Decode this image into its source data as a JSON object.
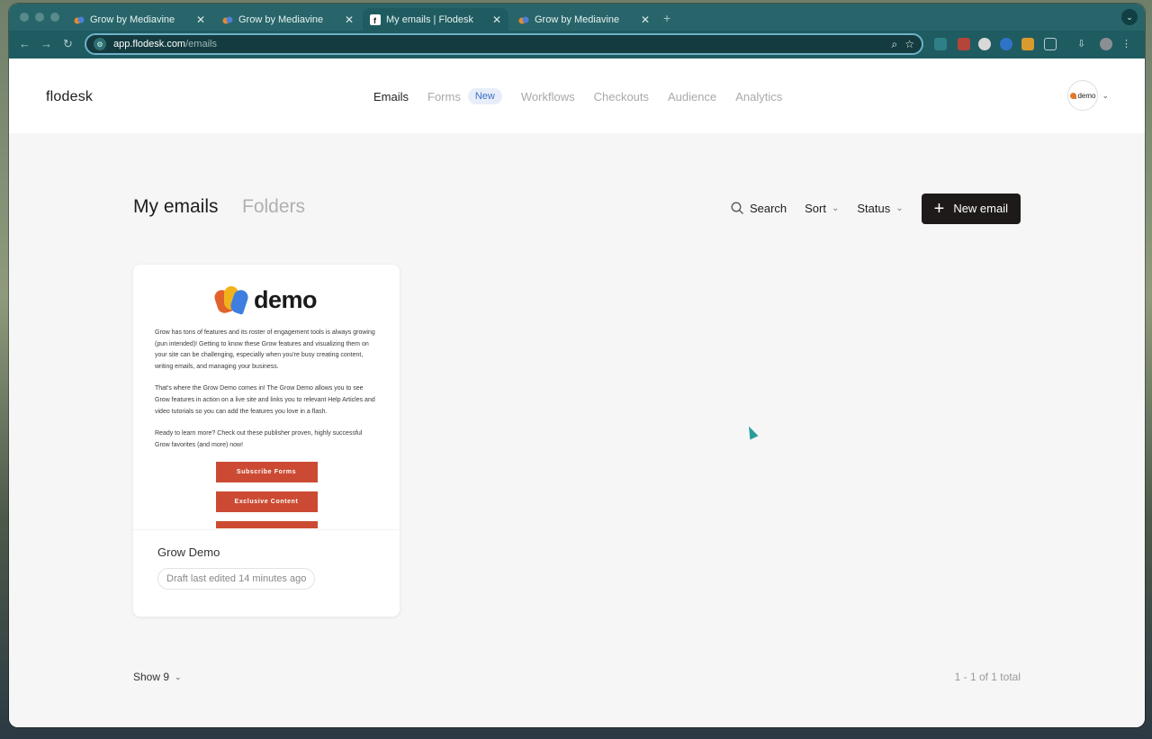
{
  "browser": {
    "tabs": [
      {
        "title": "Grow by Mediavine",
        "active": false
      },
      {
        "title": "Grow by Mediavine",
        "active": false
      },
      {
        "title": "My emails | Flodesk",
        "active": true
      },
      {
        "title": "Grow by Mediavine",
        "active": false
      }
    ],
    "new_tab_icon": "plus-icon",
    "url_host": "app.flodesk.com",
    "url_path": "/emails"
  },
  "app": {
    "logo": "flodesk",
    "nav": [
      {
        "label": "Emails",
        "active": true
      },
      {
        "label": "Forms",
        "active": false
      },
      {
        "label": "Workflows",
        "active": false
      },
      {
        "label": "Checkouts",
        "active": false
      },
      {
        "label": "Audience",
        "active": false
      },
      {
        "label": "Analytics",
        "active": false
      }
    ],
    "forms_badge": "New",
    "avatar_text": "demo"
  },
  "main": {
    "title": "My emails",
    "folders_label": "Folders",
    "search_label": "Search",
    "sort_label": "Sort",
    "status_label": "Status",
    "new_email_label": "New email"
  },
  "email_card": {
    "brand_word": "demo",
    "paragraphs": [
      "Grow has tons of features and its roster of engagement tools is always growing (pun intended)! Getting to know these Grow features and visualizing them on your site can be challenging, especially when you're busy creating content, writing emails, and managing your business.",
      "That's where the Grow Demo comes in! The Grow Demo allows you to see Grow features in action on a live site and links you to relevant Help Articles and video tutorials so you can add the features you love in a flash.",
      "Ready to learn more? Check out these publisher proven, highly successful Grow favorites (and more) now!"
    ],
    "buttons": [
      "Subscribe Forms",
      "Exclusive Content"
    ],
    "name": "Grow Demo",
    "status": "Draft last edited 14 minutes ago"
  },
  "footer": {
    "show_label": "Show 9",
    "count_text": "1 - 1 of 1 total"
  },
  "colors": {
    "accent_button": "#1f1a1a",
    "cta_red": "#cc4a33",
    "badge_blue": "#3b6fc4",
    "tab_bar": "#27656a"
  }
}
